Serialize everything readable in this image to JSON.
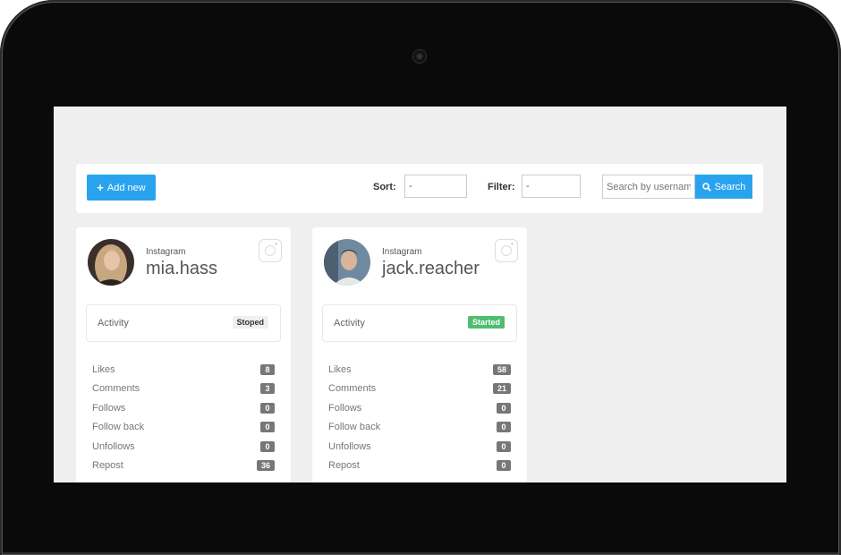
{
  "toolbar": {
    "add_label": "Add new",
    "sort_label": "Sort:",
    "sort_value": "-",
    "filter_label": "Filter:",
    "filter_value": "-",
    "search_placeholder": "Search by username",
    "search_label": "Search"
  },
  "cards": [
    {
      "platform": "Instagram",
      "username": "mia.hass",
      "activity_label": "Activity",
      "status": "Stoped",
      "stats": [
        {
          "label": "Likes",
          "value": "8"
        },
        {
          "label": "Comments",
          "value": "3"
        },
        {
          "label": "Follows",
          "value": "0"
        },
        {
          "label": "Follow back",
          "value": "0"
        },
        {
          "label": "Unfollows",
          "value": "0"
        },
        {
          "label": "Repost",
          "value": "36"
        }
      ]
    },
    {
      "platform": "Instagram",
      "username": "jack.reacher",
      "activity_label": "Activity",
      "status": "Started",
      "stats": [
        {
          "label": "Likes",
          "value": "58"
        },
        {
          "label": "Comments",
          "value": "21"
        },
        {
          "label": "Follows",
          "value": "0"
        },
        {
          "label": "Follow back",
          "value": "0"
        },
        {
          "label": "Unfollows",
          "value": "0"
        },
        {
          "label": "Repost",
          "value": "0"
        }
      ]
    }
  ],
  "colors": {
    "accent": "#2aa3ee",
    "started": "#4ebe70",
    "badge_count": "#777777"
  },
  "icons": [
    "plus-icon",
    "search-icon",
    "instagram-icon"
  ]
}
